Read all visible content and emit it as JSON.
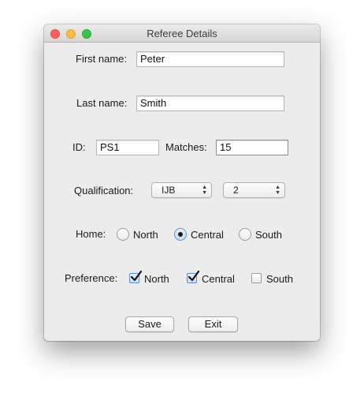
{
  "window": {
    "title": "Referee Details"
  },
  "form": {
    "first_name": {
      "label": "First name:",
      "value": "Peter"
    },
    "last_name": {
      "label": "Last name:",
      "value": "Smith"
    },
    "id": {
      "label": "ID:",
      "value": "PS1"
    },
    "matches": {
      "label": "Matches:",
      "value": "15"
    },
    "qualification": {
      "label": "Qualification:",
      "type_selected": "IJB",
      "level_selected": "2"
    },
    "home": {
      "label": "Home:",
      "options": [
        "North",
        "Central",
        "South"
      ],
      "selected": "Central"
    },
    "preference": {
      "label": "Preference:",
      "options": [
        {
          "label": "North",
          "checked": true
        },
        {
          "label": "Central",
          "checked": true
        },
        {
          "label": "South",
          "checked": false
        }
      ]
    }
  },
  "buttons": {
    "save": "Save",
    "exit": "Exit"
  }
}
